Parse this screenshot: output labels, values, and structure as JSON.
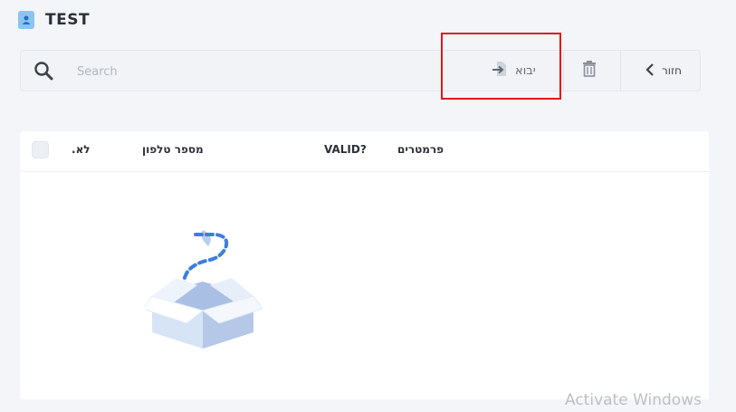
{
  "app": {
    "title": "TEST"
  },
  "toolbar": {
    "search_placeholder": "Search",
    "import_label": "יבוא",
    "back_label": "חזור"
  },
  "table": {
    "columns": [
      ".לא",
      "מספר טלפון",
      "VALID?",
      "פרמטרים"
    ],
    "rows": []
  },
  "watermark": "Activate Windows"
}
